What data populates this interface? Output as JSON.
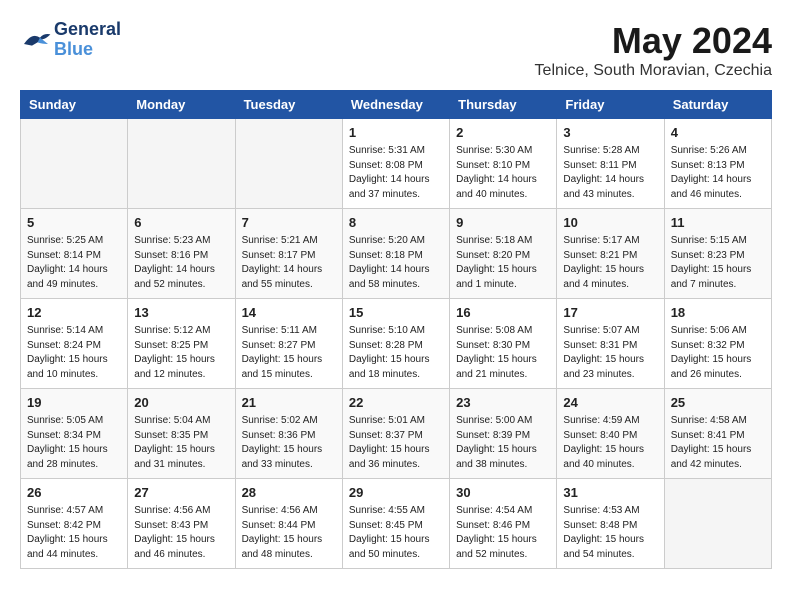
{
  "header": {
    "logo_general": "General",
    "logo_blue": "Blue",
    "month_year": "May 2024",
    "location": "Telnice, South Moravian, Czechia"
  },
  "days_of_week": [
    "Sunday",
    "Monday",
    "Tuesday",
    "Wednesday",
    "Thursday",
    "Friday",
    "Saturday"
  ],
  "weeks": [
    [
      {
        "day": "",
        "info": ""
      },
      {
        "day": "",
        "info": ""
      },
      {
        "day": "",
        "info": ""
      },
      {
        "day": "1",
        "info": "Sunrise: 5:31 AM\nSunset: 8:08 PM\nDaylight: 14 hours\nand 37 minutes."
      },
      {
        "day": "2",
        "info": "Sunrise: 5:30 AM\nSunset: 8:10 PM\nDaylight: 14 hours\nand 40 minutes."
      },
      {
        "day": "3",
        "info": "Sunrise: 5:28 AM\nSunset: 8:11 PM\nDaylight: 14 hours\nand 43 minutes."
      },
      {
        "day": "4",
        "info": "Sunrise: 5:26 AM\nSunset: 8:13 PM\nDaylight: 14 hours\nand 46 minutes."
      }
    ],
    [
      {
        "day": "5",
        "info": "Sunrise: 5:25 AM\nSunset: 8:14 PM\nDaylight: 14 hours\nand 49 minutes."
      },
      {
        "day": "6",
        "info": "Sunrise: 5:23 AM\nSunset: 8:16 PM\nDaylight: 14 hours\nand 52 minutes."
      },
      {
        "day": "7",
        "info": "Sunrise: 5:21 AM\nSunset: 8:17 PM\nDaylight: 14 hours\nand 55 minutes."
      },
      {
        "day": "8",
        "info": "Sunrise: 5:20 AM\nSunset: 8:18 PM\nDaylight: 14 hours\nand 58 minutes."
      },
      {
        "day": "9",
        "info": "Sunrise: 5:18 AM\nSunset: 8:20 PM\nDaylight: 15 hours\nand 1 minute."
      },
      {
        "day": "10",
        "info": "Sunrise: 5:17 AM\nSunset: 8:21 PM\nDaylight: 15 hours\nand 4 minutes."
      },
      {
        "day": "11",
        "info": "Sunrise: 5:15 AM\nSunset: 8:23 PM\nDaylight: 15 hours\nand 7 minutes."
      }
    ],
    [
      {
        "day": "12",
        "info": "Sunrise: 5:14 AM\nSunset: 8:24 PM\nDaylight: 15 hours\nand 10 minutes."
      },
      {
        "day": "13",
        "info": "Sunrise: 5:12 AM\nSunset: 8:25 PM\nDaylight: 15 hours\nand 12 minutes."
      },
      {
        "day": "14",
        "info": "Sunrise: 5:11 AM\nSunset: 8:27 PM\nDaylight: 15 hours\nand 15 minutes."
      },
      {
        "day": "15",
        "info": "Sunrise: 5:10 AM\nSunset: 8:28 PM\nDaylight: 15 hours\nand 18 minutes."
      },
      {
        "day": "16",
        "info": "Sunrise: 5:08 AM\nSunset: 8:30 PM\nDaylight: 15 hours\nand 21 minutes."
      },
      {
        "day": "17",
        "info": "Sunrise: 5:07 AM\nSunset: 8:31 PM\nDaylight: 15 hours\nand 23 minutes."
      },
      {
        "day": "18",
        "info": "Sunrise: 5:06 AM\nSunset: 8:32 PM\nDaylight: 15 hours\nand 26 minutes."
      }
    ],
    [
      {
        "day": "19",
        "info": "Sunrise: 5:05 AM\nSunset: 8:34 PM\nDaylight: 15 hours\nand 28 minutes."
      },
      {
        "day": "20",
        "info": "Sunrise: 5:04 AM\nSunset: 8:35 PM\nDaylight: 15 hours\nand 31 minutes."
      },
      {
        "day": "21",
        "info": "Sunrise: 5:02 AM\nSunset: 8:36 PM\nDaylight: 15 hours\nand 33 minutes."
      },
      {
        "day": "22",
        "info": "Sunrise: 5:01 AM\nSunset: 8:37 PM\nDaylight: 15 hours\nand 36 minutes."
      },
      {
        "day": "23",
        "info": "Sunrise: 5:00 AM\nSunset: 8:39 PM\nDaylight: 15 hours\nand 38 minutes."
      },
      {
        "day": "24",
        "info": "Sunrise: 4:59 AM\nSunset: 8:40 PM\nDaylight: 15 hours\nand 40 minutes."
      },
      {
        "day": "25",
        "info": "Sunrise: 4:58 AM\nSunset: 8:41 PM\nDaylight: 15 hours\nand 42 minutes."
      }
    ],
    [
      {
        "day": "26",
        "info": "Sunrise: 4:57 AM\nSunset: 8:42 PM\nDaylight: 15 hours\nand 44 minutes."
      },
      {
        "day": "27",
        "info": "Sunrise: 4:56 AM\nSunset: 8:43 PM\nDaylight: 15 hours\nand 46 minutes."
      },
      {
        "day": "28",
        "info": "Sunrise: 4:56 AM\nSunset: 8:44 PM\nDaylight: 15 hours\nand 48 minutes."
      },
      {
        "day": "29",
        "info": "Sunrise: 4:55 AM\nSunset: 8:45 PM\nDaylight: 15 hours\nand 50 minutes."
      },
      {
        "day": "30",
        "info": "Sunrise: 4:54 AM\nSunset: 8:46 PM\nDaylight: 15 hours\nand 52 minutes."
      },
      {
        "day": "31",
        "info": "Sunrise: 4:53 AM\nSunset: 8:48 PM\nDaylight: 15 hours\nand 54 minutes."
      },
      {
        "day": "",
        "info": ""
      }
    ]
  ]
}
